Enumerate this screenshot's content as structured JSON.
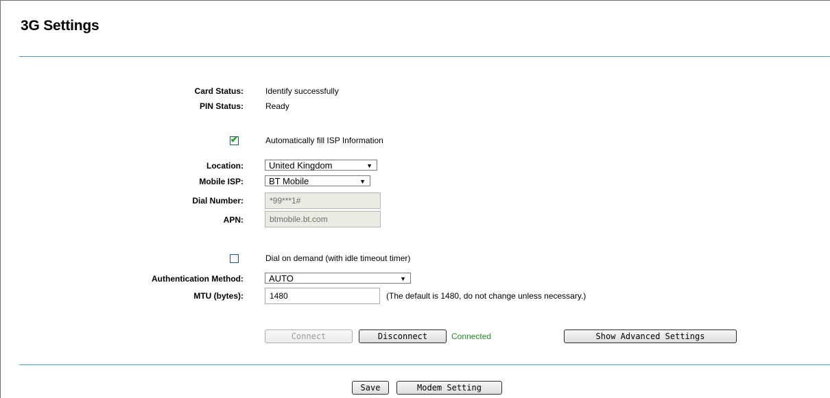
{
  "page": {
    "title": "3G Settings"
  },
  "status": {
    "card_label": "Card Status:",
    "card_value": "Identify successfully",
    "pin_label": "PIN Status:",
    "pin_value": "Ready"
  },
  "auto_fill": {
    "checked": true,
    "label": "Automatically fill ISP Information"
  },
  "isp": {
    "location_label": "Location:",
    "location_value": "United Kingdom",
    "mobile_isp_label": "Mobile ISP:",
    "mobile_isp_value": "BT Mobile",
    "dial_label": "Dial Number:",
    "dial_value": "*99***1#",
    "apn_label": "APN:",
    "apn_value": "btmobile.bt.com"
  },
  "dial_on_demand": {
    "checked": false,
    "label": "Dial on demand (with idle timeout timer)"
  },
  "auth": {
    "label": "Authentication Method:",
    "value": "AUTO"
  },
  "mtu": {
    "label": "MTU (bytes):",
    "value": "1480",
    "hint": "(The default is 1480, do not change unless necessary.)"
  },
  "connection": {
    "connect_label": "Connect",
    "disconnect_label": "Disconnect",
    "status_text": "Connected",
    "status_color": "#228b22",
    "advanced_label": "Show Advanced Settings"
  },
  "footer": {
    "save_label": "Save",
    "modem_label": "Modem Setting"
  },
  "icons": {
    "dropdown": "chevron-down-icon",
    "check": "checkmark-icon"
  },
  "colors": {
    "rule": "#4f95b8"
  }
}
